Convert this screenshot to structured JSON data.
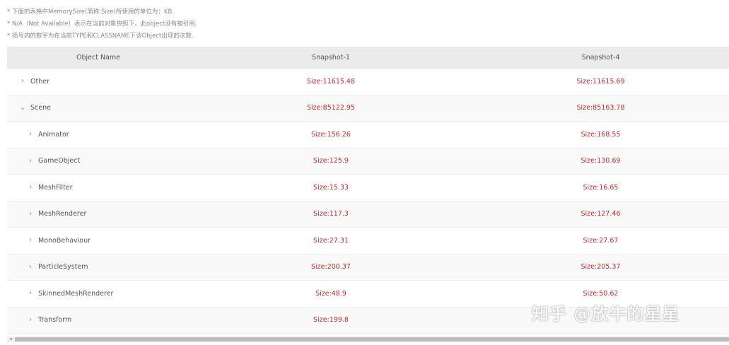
{
  "notes": [
    "* 下面的表格中MemorySize(简称:Size)所使用的单位为：KB.",
    "* N/A（Not Available）表示在当前对象快照下，此object没有被引用.",
    "* 括号内的数字为在当前TYPE和CLASSNAME下该Object出现的次数."
  ],
  "table": {
    "headers": {
      "name": "Object Name",
      "s1": "Snapshot-1",
      "s4": "Snapshot-4"
    },
    "rows": [
      {
        "name": "Other",
        "chev": "›",
        "s1": "Size:11615.48",
        "s4": "Size:11615.69"
      },
      {
        "name": "Scene",
        "chev": "⌄",
        "s1": "Size:85122.95",
        "s4": "Size:85163.78"
      },
      {
        "name": "Animator",
        "chev": "›",
        "s1": "Size:156.26",
        "s4": "Size:168.55"
      },
      {
        "name": "GameObject",
        "chev": "›",
        "s1": "Size:125.9",
        "s4": "Size:130.69"
      },
      {
        "name": "MeshFilter",
        "chev": "›",
        "s1": "Size:15.33",
        "s4": "Size:16.65"
      },
      {
        "name": "MeshRenderer",
        "chev": "›",
        "s1": "Size:117.3",
        "s4": "Size:127.46"
      },
      {
        "name": "MonoBehaviour",
        "chev": "›",
        "s1": "Size:27.31",
        "s4": "Size:27.67"
      },
      {
        "name": "ParticleSystem",
        "chev": "›",
        "s1": "Size:200.37",
        "s4": "Size:205.37"
      },
      {
        "name": "SkinnedMeshRenderer",
        "chev": "›",
        "s1": "Size:48.9",
        "s4": "Size:50.62"
      },
      {
        "name": "Transform",
        "chev": "›",
        "s1": "Size:199.8",
        "s4": ""
      }
    ]
  },
  "scrollbar": {
    "left_arrow": "◂"
  },
  "watermark": "知乎 @放牛的星星",
  "colors": {
    "size_text": "#c62828",
    "header_bg": "#ebebeb"
  }
}
